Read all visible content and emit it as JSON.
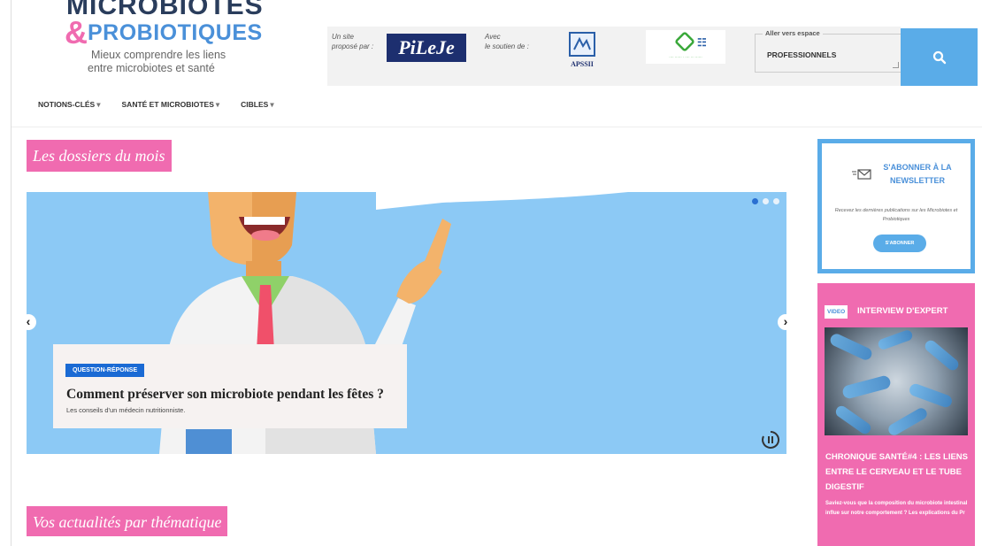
{
  "logo": {
    "line1": "MICROBIOTES",
    "amp": "&",
    "line2": "PROBIOTIQUES",
    "tagline1": "Mieux comprendre les liens",
    "tagline2": "entre microbiotes et santé"
  },
  "partners": {
    "proposed_label_1": "Un site",
    "proposed_label_2": "proposé par :",
    "pileje": "PiLeJe",
    "support_label_1": "Avec",
    "support_label_2": "le soutien de :",
    "apsh": "APSSII"
  },
  "space_select": {
    "legend": "Aller vers espace",
    "value": "PROFESSIONNELS"
  },
  "nav": {
    "items": [
      {
        "label": "NOTIONS-CLÉS"
      },
      {
        "label": "SANTÉ ET MICROBIOTES"
      },
      {
        "label": "CIBLES"
      }
    ]
  },
  "sections": {
    "dossiers_title": "Les dossiers du mois",
    "actualites_title": "Vos actualités par thématique"
  },
  "carousel": {
    "badge": "QUESTION-RÉPONSE",
    "title": "Comment préserver son microbiote pendant les fêtes ?",
    "subtitle": "Les conseils d'un médecin nutritionniste.",
    "prev": "‹",
    "next": "›"
  },
  "newsletter": {
    "title_1": "S'ABONNER À LA",
    "title_2": "NEWSLETTER",
    "description": "Recevez les dernières publications sur les Microbiotes et Probiotiques",
    "button": "S'ABONNER"
  },
  "video": {
    "badge": "VIDEO",
    "label": "INTERVIEW D'EXPERT",
    "title": "CHRONIQUE SANTÉ#4 : LES LIENS ENTRE LE CERVEAU ET LE TUBE DIGESTIF",
    "description": "Saviez-vous que la composition du microbiote intestinal influe sur notre comportement ? Les explications du Pr"
  },
  "colors": {
    "pink": "#f06bb0",
    "blue": "#5aace8",
    "navy": "#2a3d5c",
    "sky": "#8cc9f5"
  }
}
